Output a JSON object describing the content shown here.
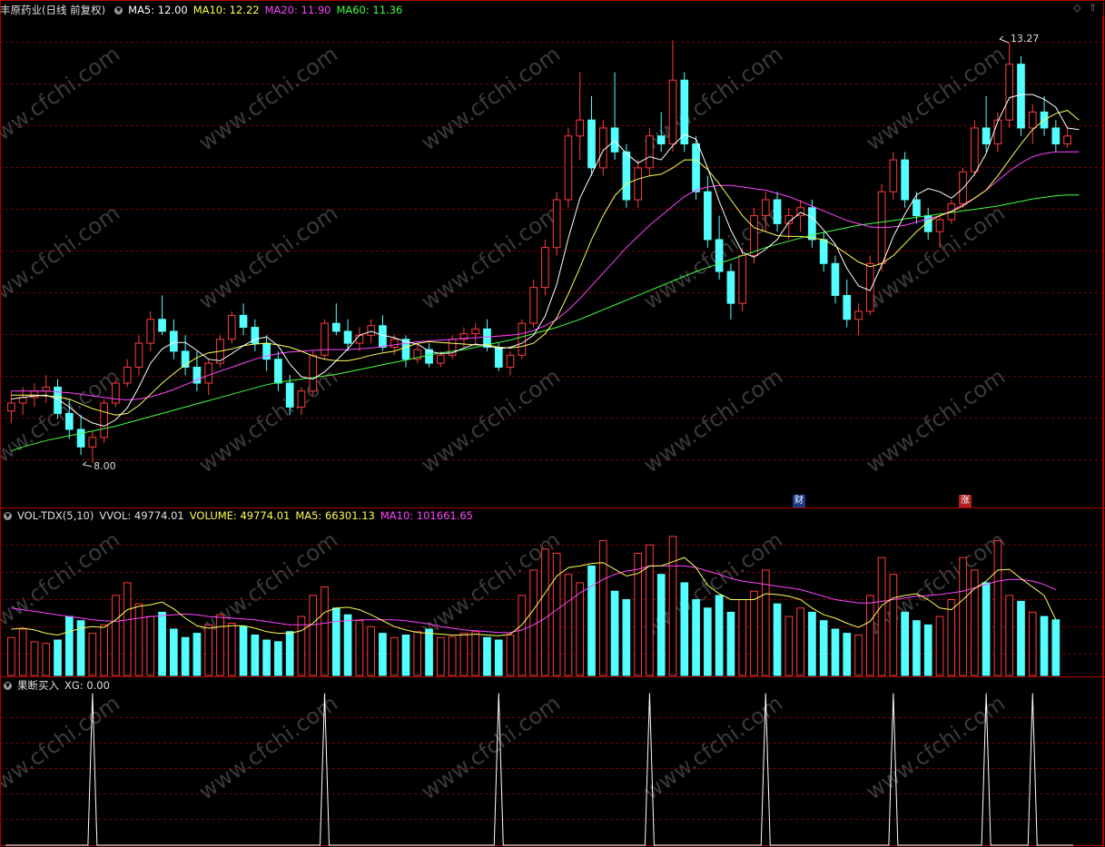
{
  "panel_price": {
    "title": "丰原药业(日线 前复权)",
    "ma5": "MA5: 12.00",
    "ma10": "MA10: 12.22",
    "ma20": "MA20: 11.90",
    "ma60": "MA60: 11.36",
    "high_label": "13.27",
    "low_label": "8.00",
    "badge_cai": "财",
    "badge_zhang": "涨"
  },
  "panel_volume": {
    "title": "VOL-TDX(5,10)",
    "vvol": "VVOL: 49774.01",
    "volume": "VOLUME: 49774.01",
    "ma5": "MA5: 66301.13",
    "ma10": "MA10: 101661.65"
  },
  "panel_signal": {
    "title": "果断买入",
    "xg": "XG: 0.00"
  },
  "watermark": "www.cfchi.com",
  "colors": {
    "up": "#ff3c3c",
    "down": "#54ffff",
    "ma5": "#ffffff",
    "ma10": "#ffff55",
    "ma20": "#ff44ff",
    "ma60": "#44ff44",
    "grid": "#7a0000",
    "border": "#b00000",
    "signal": "#ffffff"
  },
  "chart_data": [
    {
      "type": "candlestick",
      "ylim": [
        7.6,
        13.6
      ],
      "ohlc": [
        [
          8.65,
          8.9,
          8.5,
          8.75
        ],
        [
          8.75,
          8.95,
          8.6,
          8.82
        ],
        [
          8.82,
          9.0,
          8.7,
          8.9
        ],
        [
          8.9,
          9.1,
          8.75,
          8.95
        ],
        [
          8.95,
          9.05,
          8.55,
          8.62
        ],
        [
          8.62,
          8.8,
          8.3,
          8.42
        ],
        [
          8.42,
          8.6,
          8.1,
          8.2
        ],
        [
          8.2,
          8.4,
          8.0,
          8.32
        ],
        [
          8.32,
          8.8,
          8.25,
          8.75
        ],
        [
          8.75,
          9.05,
          8.7,
          9.0
        ],
        [
          9.0,
          9.3,
          8.95,
          9.2
        ],
        [
          9.2,
          9.6,
          9.1,
          9.5
        ],
        [
          9.5,
          9.9,
          9.4,
          9.8
        ],
        [
          9.8,
          10.1,
          9.6,
          9.65
        ],
        [
          9.65,
          9.8,
          9.3,
          9.4
        ],
        [
          9.4,
          9.6,
          9.1,
          9.2
        ],
        [
          9.2,
          9.4,
          8.9,
          9.0
        ],
        [
          9.0,
          9.3,
          8.85,
          9.25
        ],
        [
          9.25,
          9.6,
          9.2,
          9.55
        ],
        [
          9.55,
          9.9,
          9.5,
          9.85
        ],
        [
          9.85,
          10.0,
          9.6,
          9.7
        ],
        [
          9.7,
          9.8,
          9.4,
          9.5
        ],
        [
          9.5,
          9.6,
          9.15,
          9.3
        ],
        [
          9.3,
          9.4,
          8.9,
          9.0
        ],
        [
          9.0,
          9.1,
          8.6,
          8.7
        ],
        [
          8.7,
          8.95,
          8.6,
          8.9
        ],
        [
          8.9,
          9.4,
          8.85,
          9.35
        ],
        [
          9.35,
          9.8,
          9.3,
          9.75
        ],
        [
          9.75,
          10.0,
          9.6,
          9.65
        ],
        [
          9.65,
          9.8,
          9.4,
          9.5
        ],
        [
          9.5,
          9.7,
          9.4,
          9.6
        ],
        [
          9.6,
          9.8,
          9.5,
          9.72
        ],
        [
          9.72,
          9.85,
          9.4,
          9.45
        ],
        [
          9.45,
          9.6,
          9.35,
          9.55
        ],
        [
          9.55,
          9.6,
          9.2,
          9.3
        ],
        [
          9.3,
          9.5,
          9.25,
          9.42
        ],
        [
          9.42,
          9.5,
          9.2,
          9.25
        ],
        [
          9.25,
          9.4,
          9.2,
          9.35
        ],
        [
          9.35,
          9.6,
          9.3,
          9.55
        ],
        [
          9.55,
          9.7,
          9.45,
          9.62
        ],
        [
          9.62,
          9.75,
          9.5,
          9.68
        ],
        [
          9.68,
          9.8,
          9.4,
          9.45
        ],
        [
          9.45,
          9.5,
          9.15,
          9.2
        ],
        [
          9.2,
          9.4,
          9.1,
          9.35
        ],
        [
          9.35,
          9.8,
          9.3,
          9.75
        ],
        [
          9.75,
          10.3,
          9.7,
          10.2
        ],
        [
          10.2,
          10.8,
          10.1,
          10.7
        ],
        [
          10.7,
          11.4,
          10.6,
          11.3
        ],
        [
          11.3,
          12.2,
          11.2,
          12.1
        ],
        [
          12.1,
          12.9,
          11.8,
          12.3
        ],
        [
          12.3,
          12.6,
          11.6,
          11.7
        ],
        [
          11.7,
          12.3,
          11.6,
          12.2
        ],
        [
          12.2,
          12.9,
          11.8,
          11.9
        ],
        [
          11.9,
          12.0,
          11.2,
          11.3
        ],
        [
          11.3,
          11.8,
          11.2,
          11.7
        ],
        [
          11.7,
          12.2,
          11.6,
          12.1
        ],
        [
          12.1,
          12.4,
          11.9,
          12.0
        ],
        [
          12.0,
          13.3,
          11.9,
          12.8
        ],
        [
          12.8,
          12.9,
          11.9,
          12.0
        ],
        [
          12.0,
          12.1,
          11.3,
          11.4
        ],
        [
          11.4,
          11.6,
          10.7,
          10.8
        ],
        [
          10.8,
          11.1,
          10.3,
          10.4
        ],
        [
          10.4,
          10.5,
          9.8,
          10.0
        ],
        [
          10.0,
          10.7,
          9.9,
          10.6
        ],
        [
          10.6,
          11.2,
          10.5,
          11.1
        ],
        [
          11.1,
          11.4,
          10.9,
          11.3
        ],
        [
          11.3,
          11.4,
          10.9,
          11.0
        ],
        [
          11.0,
          11.2,
          10.8,
          11.1
        ],
        [
          11.1,
          11.3,
          10.9,
          11.2
        ],
        [
          11.2,
          11.3,
          10.7,
          10.8
        ],
        [
          10.8,
          10.9,
          10.4,
          10.5
        ],
        [
          10.5,
          10.6,
          10.0,
          10.1
        ],
        [
          10.1,
          10.3,
          9.7,
          9.8
        ],
        [
          9.8,
          10.0,
          9.6,
          9.9
        ],
        [
          9.9,
          10.6,
          9.85,
          10.5
        ],
        [
          10.5,
          11.5,
          10.4,
          11.4
        ],
        [
          11.4,
          11.9,
          11.3,
          11.8
        ],
        [
          11.8,
          11.9,
          11.2,
          11.3
        ],
        [
          11.3,
          11.4,
          11.0,
          11.1
        ],
        [
          11.1,
          11.2,
          10.8,
          10.9
        ],
        [
          10.9,
          11.1,
          10.7,
          11.05
        ],
        [
          11.05,
          11.3,
          11.0,
          11.25
        ],
        [
          11.25,
          11.7,
          11.2,
          11.65
        ],
        [
          11.65,
          12.3,
          11.6,
          12.2
        ],
        [
          12.2,
          12.6,
          11.9,
          12.0
        ],
        [
          12.0,
          12.4,
          11.9,
          12.3
        ],
        [
          12.3,
          13.27,
          12.2,
          13.0
        ],
        [
          13.0,
          13.1,
          12.1,
          12.2
        ],
        [
          12.2,
          12.5,
          12.0,
          12.4
        ],
        [
          12.4,
          12.6,
          12.1,
          12.2
        ],
        [
          12.2,
          12.3,
          11.9,
          12.0
        ],
        [
          12.0,
          12.2,
          11.95,
          12.1
        ]
      ],
      "ma5": [
        8.8,
        8.82,
        8.84,
        8.85,
        8.8,
        8.7,
        8.58,
        8.5,
        8.46,
        8.54,
        8.69,
        8.95,
        9.25,
        9.43,
        9.51,
        9.51,
        9.41,
        9.3,
        9.28,
        9.37,
        9.47,
        9.55,
        9.58,
        9.47,
        9.24,
        9.08,
        9.05,
        9.14,
        9.28,
        9.43,
        9.6,
        9.65,
        9.6,
        9.57,
        9.52,
        9.49,
        9.4,
        9.37,
        9.38,
        9.44,
        9.49,
        9.47,
        9.43,
        9.45,
        9.5,
        9.6,
        9.84,
        10.24,
        10.82,
        11.32,
        11.62,
        11.92,
        12.04,
        11.88,
        11.76,
        11.84,
        11.8,
        11.98,
        12.12,
        12.06,
        11.7,
        11.28,
        10.92,
        10.64,
        10.58,
        10.68,
        10.8,
        11.02,
        11.14,
        11.08,
        10.92,
        10.74,
        10.44,
        10.22,
        10.16,
        10.48,
        10.84,
        11.12,
        11.36,
        11.44,
        11.4,
        11.32,
        11.44,
        11.62,
        11.88,
        12.28,
        12.58,
        12.62,
        12.62,
        12.56,
        12.46,
        12.2,
        12.18
      ],
      "ma10": [
        8.85,
        8.85,
        8.85,
        8.84,
        8.83,
        8.8,
        8.74,
        8.68,
        8.64,
        8.6,
        8.62,
        8.72,
        8.86,
        9.0,
        9.12,
        9.23,
        9.32,
        9.38,
        9.4,
        9.43,
        9.47,
        9.49,
        9.5,
        9.48,
        9.45,
        9.4,
        9.34,
        9.3,
        9.28,
        9.28,
        9.31,
        9.35,
        9.38,
        9.4,
        9.45,
        9.5,
        9.52,
        9.51,
        9.5,
        9.49,
        9.48,
        9.48,
        9.45,
        9.44,
        9.46,
        9.5,
        9.62,
        9.82,
        10.12,
        10.45,
        10.8,
        11.1,
        11.35,
        11.5,
        11.56,
        11.6,
        11.62,
        11.7,
        11.8,
        11.8,
        11.68,
        11.5,
        11.3,
        11.1,
        10.95,
        10.9,
        10.85,
        10.84,
        10.84,
        10.82,
        10.8,
        10.72,
        10.62,
        10.52,
        10.46,
        10.5,
        10.6,
        10.75,
        10.9,
        11.02,
        11.1,
        11.15,
        11.22,
        11.32,
        11.42,
        11.6,
        11.8,
        12.0,
        12.18,
        12.3,
        12.38,
        12.42,
        12.3
      ],
      "ma20": [
        8.9,
        8.9,
        8.9,
        8.9,
        8.89,
        8.88,
        8.86,
        8.84,
        8.82,
        8.8,
        8.79,
        8.8,
        8.83,
        8.87,
        8.92,
        8.98,
        9.04,
        9.1,
        9.15,
        9.2,
        9.25,
        9.3,
        9.34,
        9.37,
        9.39,
        9.4,
        9.41,
        9.42,
        9.42,
        9.42,
        9.43,
        9.44,
        9.46,
        9.48,
        9.5,
        9.52,
        9.53,
        9.54,
        9.55,
        9.56,
        9.57,
        9.58,
        9.59,
        9.6,
        9.62,
        9.66,
        9.72,
        9.8,
        9.92,
        10.06,
        10.22,
        10.38,
        10.54,
        10.7,
        10.84,
        10.98,
        11.1,
        11.22,
        11.34,
        11.42,
        11.46,
        11.48,
        11.48,
        11.46,
        11.44,
        11.42,
        11.38,
        11.34,
        11.28,
        11.22,
        11.16,
        11.1,
        11.04,
        11.0,
        10.96,
        10.95,
        10.96,
        10.98,
        11.02,
        11.06,
        11.1,
        11.16,
        11.24,
        11.32,
        11.42,
        11.54,
        11.66,
        11.76,
        11.84,
        11.88,
        11.9,
        11.9,
        11.9
      ],
      "ma60": [
        8.15,
        8.2,
        8.24,
        8.28,
        8.31,
        8.34,
        8.37,
        8.4,
        8.43,
        8.46,
        8.5,
        8.54,
        8.58,
        8.62,
        8.66,
        8.7,
        8.74,
        8.78,
        8.82,
        8.86,
        8.9,
        8.94,
        8.98,
        9.01,
        9.03,
        9.05,
        9.07,
        9.09,
        9.11,
        9.14,
        9.17,
        9.2,
        9.23,
        9.26,
        9.29,
        9.32,
        9.35,
        9.38,
        9.4,
        9.42,
        9.45,
        9.48,
        9.51,
        9.54,
        9.58,
        9.62,
        9.66,
        9.7,
        9.75,
        9.8,
        9.86,
        9.92,
        9.98,
        10.04,
        10.1,
        10.16,
        10.22,
        10.28,
        10.34,
        10.4,
        10.45,
        10.5,
        10.55,
        10.6,
        10.65,
        10.7,
        10.74,
        10.78,
        10.82,
        10.86,
        10.89,
        10.92,
        10.95,
        10.98,
        11.0,
        11.02,
        11.04,
        11.06,
        11.08,
        11.1,
        11.12,
        11.14,
        11.16,
        11.18,
        11.2,
        11.22,
        11.25,
        11.28,
        11.31,
        11.33,
        11.35,
        11.36,
        11.36
      ],
      "high_mark": {
        "index": 85,
        "value": 13.27
      },
      "low_mark": {
        "index": 6,
        "value": 8.0
      }
    },
    {
      "type": "bar",
      "series_name": "VOLUME",
      "values": [
        45000,
        55000,
        40000,
        38000,
        42000,
        70000,
        65000,
        50000,
        60000,
        95000,
        110000,
        85000,
        70000,
        75000,
        55000,
        45000,
        50000,
        60000,
        72000,
        62000,
        58000,
        48000,
        42000,
        40000,
        52000,
        70000,
        95000,
        105000,
        80000,
        72000,
        65000,
        58000,
        50000,
        45000,
        48000,
        52000,
        55000,
        45000,
        46000,
        50000,
        52000,
        45000,
        42000,
        48000,
        95000,
        125000,
        150000,
        145000,
        120000,
        110000,
        130000,
        160000,
        100000,
        90000,
        145000,
        155000,
        120000,
        165000,
        110000,
        90000,
        80000,
        95000,
        75000,
        90000,
        100000,
        125000,
        85000,
        70000,
        80000,
        75000,
        65000,
        55000,
        50000,
        48000,
        95000,
        140000,
        120000,
        75000,
        65000,
        60000,
        70000,
        90000,
        140000,
        125000,
        110000,
        160000,
        95000,
        88000,
        75000,
        70000,
        66000
      ],
      "ma5": [
        55000,
        56000,
        54000,
        50000,
        48000,
        52000,
        56000,
        58000,
        57000,
        66000,
        78000,
        82000,
        84000,
        87000,
        79000,
        68000,
        59000,
        56000,
        58000,
        59000,
        59000,
        56000,
        52000,
        50000,
        50000,
        53000,
        62000,
        75000,
        80000,
        81000,
        78000,
        72000,
        65000,
        58000,
        54000,
        51000,
        50000,
        49000,
        48000,
        48000,
        49000,
        48000,
        47000,
        49000,
        60000,
        78000,
        98000,
        118000,
        128000,
        130000,
        133000,
        134000,
        126000,
        118000,
        121000,
        130000,
        130000,
        135000,
        140000,
        128000,
        107000,
        97000,
        90000,
        90000,
        90000,
        97000,
        96000,
        94000,
        90000,
        80000,
        72000,
        68000,
        62000,
        57000,
        64000,
        83000,
        92000,
        95000,
        97000,
        90000,
        80000,
        78000,
        90000,
        103000,
        112000,
        125000,
        126000,
        115000,
        105000,
        95000,
        66301
      ],
      "ma10": [
        80000,
        78000,
        76000,
        74000,
        72000,
        70000,
        68000,
        66000,
        65000,
        64000,
        66000,
        68000,
        70000,
        71000,
        72000,
        73000,
        72000,
        70000,
        69000,
        68000,
        67000,
        66000,
        64000,
        62000,
        60000,
        60000,
        60000,
        62000,
        64000,
        65000,
        66000,
        66000,
        66000,
        66000,
        65000,
        63000,
        61000,
        58000,
        56000,
        54000,
        53000,
        52000,
        51000,
        51000,
        54000,
        60000,
        68000,
        78000,
        88000,
        98000,
        106000,
        114000,
        120000,
        124000,
        126000,
        130000,
        130000,
        130000,
        130000,
        128000,
        124000,
        120000,
        115000,
        112000,
        110000,
        108000,
        106000,
        104000,
        102000,
        98000,
        94000,
        90000,
        88000,
        86000,
        86000,
        88000,
        90000,
        92000,
        94000,
        95000,
        96000,
        98000,
        100000,
        104000,
        108000,
        112000,
        114000,
        114000,
        112000,
        108000,
        101662
      ],
      "ylim": [
        0,
        180000
      ]
    },
    {
      "type": "line",
      "series_name": "XG",
      "signal_indices": [
        7,
        27,
        42,
        55,
        65,
        76,
        84,
        88
      ],
      "ylim": [
        0,
        1
      ]
    }
  ]
}
